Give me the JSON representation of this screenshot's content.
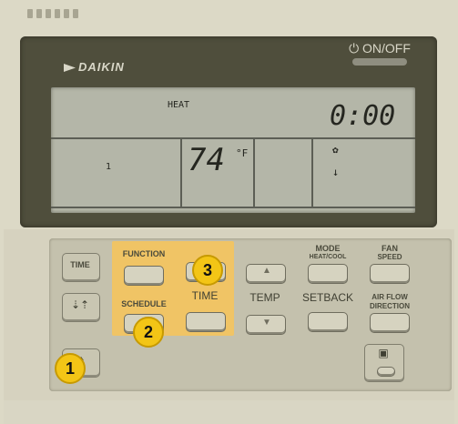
{
  "brand": "DAIKIN",
  "power": {
    "label": "ON/OFF",
    "icon": "power-icon"
  },
  "display": {
    "mode_text": "HEAT",
    "clock": "0:00",
    "temperature": "74",
    "unit": "°F",
    "indicator_left": "1"
  },
  "buttons": {
    "function": "FUNCTION",
    "schedule": "SCHEDULE",
    "time": "TIME",
    "temp": "TEMP",
    "setback": "SETBACK",
    "mode": "MODE",
    "mode_sub": "HEAT/COOL",
    "fan": "FAN",
    "fan_sub": "SPEED",
    "airflow": "AIR FLOW",
    "airflow_sub": "DIRECTION",
    "time_left": "TIME"
  },
  "badges": [
    "1",
    "2",
    "3"
  ],
  "colors": {
    "highlight": "#f0c465",
    "badge": "#f3c516",
    "lcd": "#b4b6a8"
  }
}
